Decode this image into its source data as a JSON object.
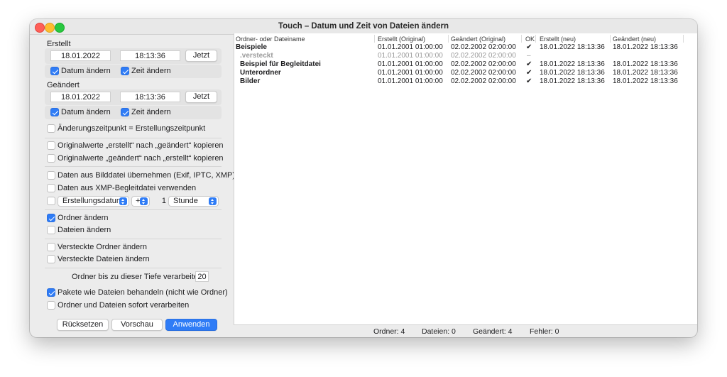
{
  "window": {
    "title": "Touch – Datum und Zeit von Dateien ändern"
  },
  "created": {
    "label": "Erstellt",
    "date": "18.01.2022",
    "time": "18:13:36",
    "now_button": "Jetzt",
    "change_date": {
      "label": "Datum ändern",
      "checked": true
    },
    "change_time": {
      "label": "Zeit ändern",
      "checked": true
    }
  },
  "modified": {
    "label": "Geändert",
    "date": "18.01.2022",
    "time": "18:13:36",
    "now_button": "Jetzt",
    "change_date": {
      "label": "Datum ändern",
      "checked": true
    },
    "change_time": {
      "label": "Zeit ändern",
      "checked": true
    }
  },
  "options": {
    "mod_equals_created": "Änderungszeitpunkt = Erstellungszeitpunkt",
    "copy_created_to_modified": "Originalwerte „erstellt“ nach „geändert“ kopieren",
    "copy_modified_to_created": "Originalwerte „geändert“ nach „erstellt“ kopieren",
    "from_image": "Daten aus Bilddatei übernehmen (Exif, IPTC, XMP)",
    "from_xmp": "Daten aus XMP-Begleitdatei verwenden",
    "offset": {
      "field": "Erstellungsdatum",
      "operator": "+",
      "amount": "1",
      "unit": "Stunde"
    },
    "change_folders": "Ordner ändern",
    "change_files": "Dateien ändern",
    "hidden_folders": "Versteckte Ordner ändern",
    "hidden_files": "Versteckte Dateien ändern",
    "depth_label": "Ordner bis zu dieser Tiefe verarbeiten:",
    "depth_value": "20",
    "packages_as_files": "Pakete wie Dateien behandeln (nicht wie Ordner)",
    "process_immediately": "Ordner und Dateien sofort verarbeiten"
  },
  "buttons": {
    "reset": "Rücksetzen",
    "preview": "Vorschau",
    "apply": "Anwenden"
  },
  "table": {
    "headers": [
      "Ordner- oder Dateiname",
      "Erstellt (Original)",
      "Geändert (Original)",
      "OK",
      "Erstellt (neu)",
      "Geändert (neu)"
    ],
    "rows": [
      {
        "name": "Beispiele",
        "created_orig": "01.01.2001  01:00:00",
        "modified_orig": "02.02.2002  02:00:00",
        "ok": "✔",
        "created_new": "18.01.2022  18:13:36",
        "modified_new": "18.01.2022  18:13:36"
      },
      {
        "name": ".versteckt",
        "created_orig": "01.01.2001  01:00:00",
        "modified_orig": "02.02.2002  02:00:00",
        "ok": "–",
        "created_new": "",
        "modified_new": ""
      },
      {
        "name": "Beispiel für Begleitdatei",
        "created_orig": "01.01.2001  01:00:00",
        "modified_orig": "02.02.2002  02:00:00",
        "ok": "✔",
        "created_new": "18.01.2022  18:13:36",
        "modified_new": "18.01.2022  18:13:36"
      },
      {
        "name": "Unterordner",
        "created_orig": "01.01.2001  01:00:00",
        "modified_orig": "02.02.2002  02:00:00",
        "ok": "✔",
        "created_new": "18.01.2022  18:13:36",
        "modified_new": "18.01.2022  18:13:36"
      },
      {
        "name": "Bilder",
        "created_orig": "01.01.2001  01:00:00",
        "modified_orig": "02.02.2002  02:00:00",
        "ok": "✔",
        "created_new": "18.01.2022  18:13:36",
        "modified_new": "18.01.2022  18:13:36"
      }
    ]
  },
  "status": {
    "folders": "Ordner: 4",
    "files": "Dateien: 0",
    "changed": "Geändert: 4",
    "errors": "Fehler: 0"
  }
}
